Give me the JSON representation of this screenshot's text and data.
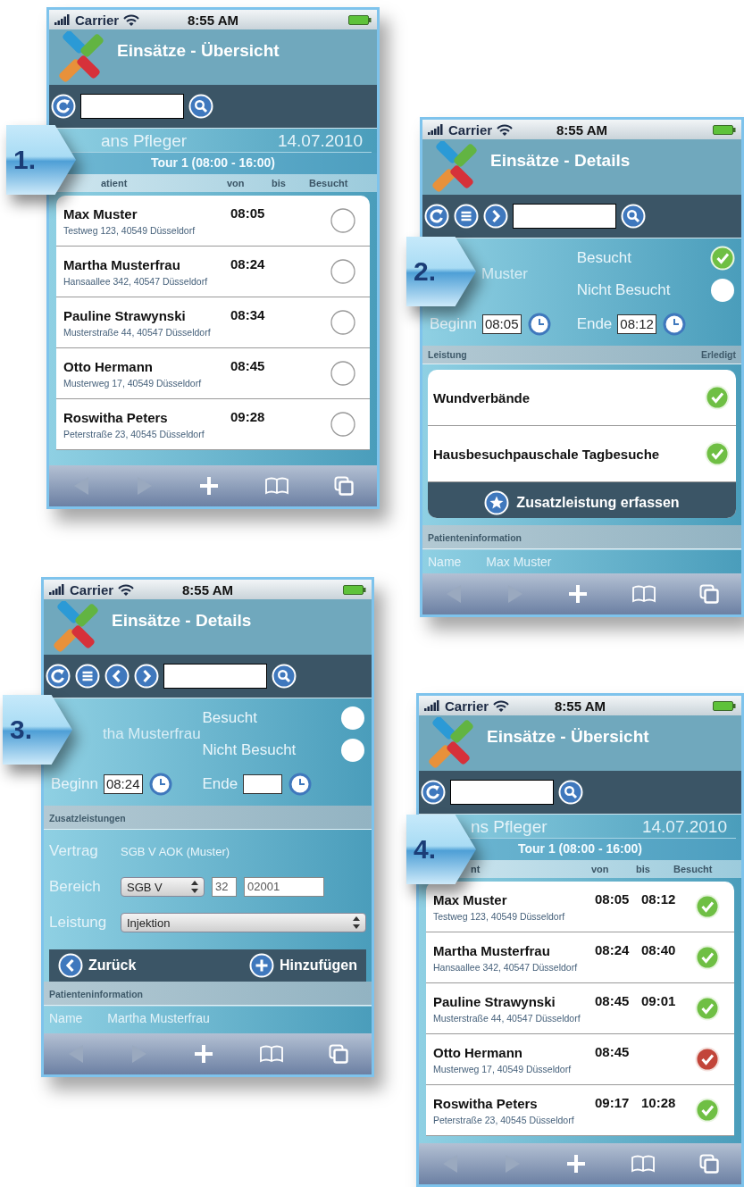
{
  "screens": [
    {
      "kind": "overview",
      "callout": "1.",
      "carrier": "Carrier",
      "time": "8:55 AM",
      "title": "Einsätze - Übersicht",
      "nurse": "ans Pfleger",
      "date": "14.07.2010",
      "tour": "Tour 1 (08:00 - 16:00)",
      "columns": [
        "atient",
        "von",
        "bis",
        "Besucht"
      ],
      "rows": [
        {
          "name": "Max Muster",
          "address": "Testweg 123, 40549 Düsseldorf",
          "from": "08:05",
          "checked": false
        },
        {
          "name": "Martha Musterfrau",
          "address": "Hansaallee 342, 40547 Düsseldorf",
          "from": "08:24",
          "checked": false
        },
        {
          "name": "Pauline Strawynski",
          "address": "Musterstraße 44, 40547 Düsseldorf",
          "from": "08:34",
          "checked": false
        },
        {
          "name": "Otto Hermann",
          "address": "Musterweg 17, 40549 Düsseldorf",
          "from": "08:45",
          "checked": false
        },
        {
          "name": "Roswitha Peters",
          "address": "Peterstraße 23, 40545 Düsseldorf",
          "from": "09:28",
          "checked": false
        }
      ]
    },
    {
      "kind": "details",
      "callout": "2.",
      "carrier": "Carrier",
      "time": "8:55 AM",
      "title": "Einsätze - Details",
      "has_previous": false,
      "patient": "Muster",
      "visited": {
        "label": "Besucht",
        "checked": true
      },
      "not_visited": {
        "label": "Nicht Besucht",
        "checked": false
      },
      "begin": {
        "label": "Beginn",
        "value": "08:05"
      },
      "end": {
        "label": "Ende",
        "value": "08:12"
      },
      "services_header": {
        "left": "Leistung",
        "right": "Erledigt"
      },
      "services": [
        {
          "name": "Wundverbände",
          "done": true
        },
        {
          "name": "Hausbesuchpauschale Tagbesuche",
          "done": true
        }
      ],
      "action": "Zusatzleistung erfassen",
      "info_header": "Patienteninformation",
      "info": [
        {
          "label": "Name",
          "value": "Max Muster"
        }
      ]
    },
    {
      "kind": "add_service",
      "callout": "3.",
      "carrier": "Carrier",
      "time": "8:55 AM",
      "title": "Einsätze - Details",
      "has_previous": true,
      "patient": "tha Musterfrau",
      "visited": {
        "label": "Besucht",
        "checked": false
      },
      "not_visited": {
        "label": "Nicht Besucht",
        "checked": false
      },
      "begin": {
        "label": "Beginn",
        "value": "08:24"
      },
      "end": {
        "label": "Ende"
      },
      "section": "Zusatzleistungen",
      "contract": {
        "label": "Vertrag",
        "value": "SGB V AOK (Muster)"
      },
      "area": {
        "label": "Bereich",
        "select": "SGB V",
        "code1": "32",
        "code2": "02001"
      },
      "service": {
        "label": "Leistung",
        "select": "Injektion"
      },
      "back": "Zurück",
      "add": "Hinzufügen",
      "info_header": "Patienteninformation",
      "info": [
        {
          "label": "Name",
          "value": "Martha Musterfrau"
        }
      ]
    },
    {
      "kind": "overview",
      "callout": "4.",
      "carrier": "Carrier",
      "time": "8:55 AM",
      "title": "Einsätze - Übersicht",
      "nurse": "ns Pfleger",
      "date": "14.07.2010",
      "tour": "Tour 1 (08:00 - 16:00)",
      "columns": [
        "nt",
        "von",
        "bis",
        "Besucht"
      ],
      "rows": [
        {
          "name": "Max Muster",
          "address": "Testweg 123, 40549 Düsseldorf",
          "from": "08:05",
          "to": "08:12",
          "checked": true,
          "missed": false
        },
        {
          "name": "Martha Musterfrau",
          "address": "Hansaallee 342, 40547 Düsseldorf",
          "from": "08:24",
          "to": "08:40",
          "checked": true,
          "missed": false
        },
        {
          "name": "Pauline Strawynski",
          "address": "Musterstraße 44, 40547 Düsseldorf",
          "from": "08:45",
          "to": "09:01",
          "checked": true,
          "missed": false
        },
        {
          "name": "Otto Hermann",
          "address": "Musterweg 17, 40549 Düsseldorf",
          "from": "08:45",
          "checked": true,
          "missed": true
        },
        {
          "name": "Roswitha Peters",
          "address": "Peterstraße 23, 40545 Düsseldorf",
          "from": "09:17",
          "to": "10:28",
          "checked": true,
          "missed": false
        }
      ]
    }
  ]
}
